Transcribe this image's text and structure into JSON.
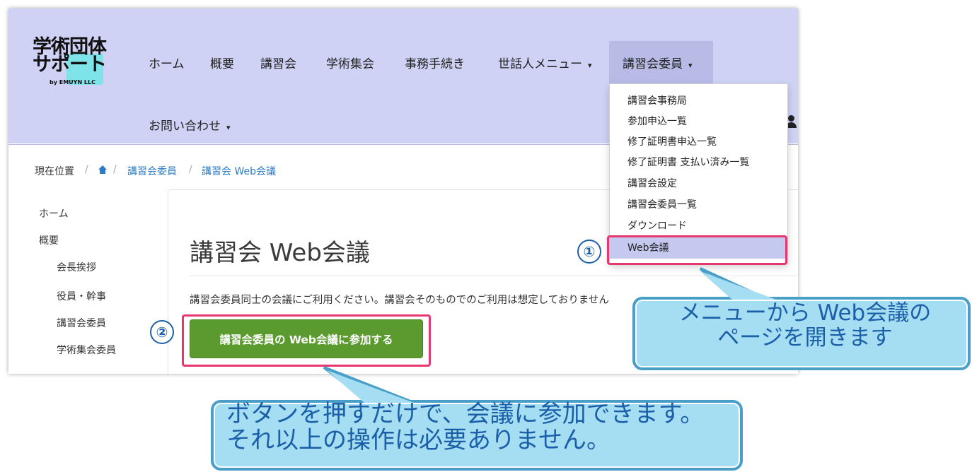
{
  "logo": {
    "line1": "学術団体",
    "line2": "サポート",
    "sub": "by EMUYN LLC"
  },
  "nav": {
    "items": [
      "ホーム",
      "概要",
      "講習会",
      "学術集会",
      "事務手続き"
    ],
    "caretaker_menu": "世話人メニュー",
    "committee_menu": "講習会委員",
    "contact_menu": "お問い合わせ",
    "caret": "▾"
  },
  "breadcrumb": {
    "current_label": "現在位置",
    "sep": "/",
    "level1": "講習会委員",
    "level2": "講習会 Web会議"
  },
  "sidebar": {
    "home": "ホーム",
    "overview": "概要",
    "items": [
      "会長挨拶",
      "役員・幹事",
      "講習会委員",
      "学術集会委員"
    ]
  },
  "main": {
    "title": "講習会 Web会議",
    "description": "講習会委員同士の会議にご利用ください。講習会そのものでのご利用は想定しておりません",
    "join_button": "講習会委員の Web会議に参加する"
  },
  "dropdown": {
    "items": [
      "講習会事務局",
      "参加申込一覧",
      "修了証明書申込一覧",
      "修了証明書 支払い済み一覧",
      "講習会設定",
      "講習会委員一覧",
      "ダウンロード",
      "Web会議"
    ]
  },
  "annotations": {
    "step1": "①",
    "step2": "②",
    "callout1_line1": "メニューから Web会議の",
    "callout1_line2": "ページを開きます",
    "callout2_line1": "ボタンを押すだけで、会議に参加できます。",
    "callout2_line2": "それ以上の操作は必要ありません。"
  },
  "colors": {
    "navbar": "#cfd2f5",
    "link": "#2d7bc6",
    "button": "#5a9a2f",
    "highlight": "#e6386f",
    "callout_fill": "#a5ddf2"
  }
}
